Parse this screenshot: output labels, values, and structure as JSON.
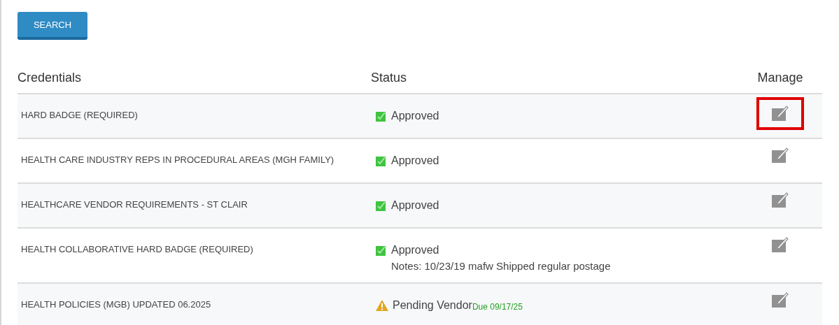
{
  "search_button": {
    "label": "SEARCH"
  },
  "table": {
    "columns": [
      "Credentials",
      "Status",
      "Manage"
    ],
    "rows": [
      {
        "credential": "HARD BADGE (REQUIRED)",
        "status": {
          "kind": "approved",
          "label": "Approved"
        },
        "highlighted": true
      },
      {
        "credential": "HEALTH CARE INDUSTRY REPS IN PROCEDURAL AREAS (MGH FAMILY)",
        "status": {
          "kind": "approved",
          "label": "Approved"
        },
        "highlighted": false
      },
      {
        "credential": "HEALTHCARE VENDOR REQUIREMENTS - ST CLAIR",
        "status": {
          "kind": "approved",
          "label": "Approved"
        },
        "highlighted": false
      },
      {
        "credential": "HEALTH COLLABORATIVE HARD BADGE (REQUIRED)",
        "status": {
          "kind": "approved",
          "label": "Approved"
        },
        "notes": "Notes: 10/23/19 mafw Shipped regular postage",
        "highlighted": false
      },
      {
        "credential": "HEALTH POLICIES (MGB) UPDATED 06.2025",
        "status": {
          "kind": "pending",
          "label": "Pending Vendor",
          "due": "Due 09/17/25"
        },
        "highlighted": false
      }
    ]
  }
}
